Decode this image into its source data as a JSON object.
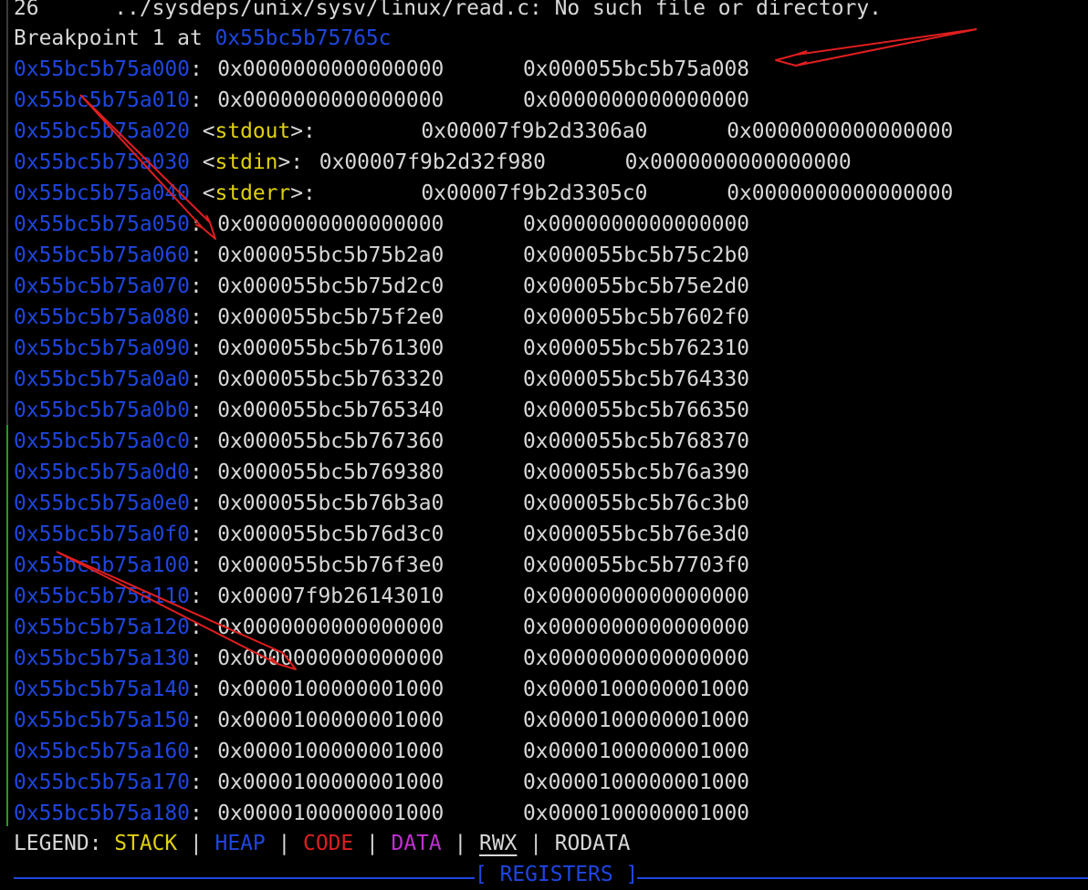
{
  "header_line": "26      ../sysdeps/unix/sysv/linux/read.c: No such file or directory.",
  "breakpoint": {
    "prefix": "Breakpoint 1 at ",
    "address": "0x55bc5b75765c"
  },
  "memory_rows": [
    {
      "addr": "0x55bc5b75a000",
      "sym": "",
      "sep": ": ",
      "v1": "0x0000000000000000",
      "v2": "0x000055bc5b75a008"
    },
    {
      "addr": "0x55bc5b75a010",
      "sym": "",
      "sep": ": ",
      "v1": "0x0000000000000000",
      "v2": "0x0000000000000000"
    },
    {
      "addr": "0x55bc5b75a020",
      "sym": "stdout",
      "sep": ":",
      "v1": "0x00007f9b2d3306a0",
      "v2": "0x0000000000000000"
    },
    {
      "addr": "0x55bc5b75a030",
      "sym": "stdin",
      "sep": ": ",
      "v1": "0x00007f9b2d32f980",
      "v2": "0x0000000000000000"
    },
    {
      "addr": "0x55bc5b75a040",
      "sym": "stderr",
      "sep": ":",
      "v1": "0x00007f9b2d3305c0",
      "v2": "0x0000000000000000"
    },
    {
      "addr": "0x55bc5b75a050",
      "sym": "",
      "sep": ": ",
      "v1": "0x0000000000000000",
      "v2": "0x0000000000000000"
    },
    {
      "addr": "0x55bc5b75a060",
      "sym": "",
      "sep": ": ",
      "v1": "0x000055bc5b75b2a0",
      "v2": "0x000055bc5b75c2b0"
    },
    {
      "addr": "0x55bc5b75a070",
      "sym": "",
      "sep": ": ",
      "v1": "0x000055bc5b75d2c0",
      "v2": "0x000055bc5b75e2d0"
    },
    {
      "addr": "0x55bc5b75a080",
      "sym": "",
      "sep": ": ",
      "v1": "0x000055bc5b75f2e0",
      "v2": "0x000055bc5b7602f0"
    },
    {
      "addr": "0x55bc5b75a090",
      "sym": "",
      "sep": ": ",
      "v1": "0x000055bc5b761300",
      "v2": "0x000055bc5b762310"
    },
    {
      "addr": "0x55bc5b75a0a0",
      "sym": "",
      "sep": ": ",
      "v1": "0x000055bc5b763320",
      "v2": "0x000055bc5b764330"
    },
    {
      "addr": "0x55bc5b75a0b0",
      "sym": "",
      "sep": ": ",
      "v1": "0x000055bc5b765340",
      "v2": "0x000055bc5b766350"
    },
    {
      "addr": "0x55bc5b75a0c0",
      "sym": "",
      "sep": ": ",
      "v1": "0x000055bc5b767360",
      "v2": "0x000055bc5b768370"
    },
    {
      "addr": "0x55bc5b75a0d0",
      "sym": "",
      "sep": ": ",
      "v1": "0x000055bc5b769380",
      "v2": "0x000055bc5b76a390"
    },
    {
      "addr": "0x55bc5b75a0e0",
      "sym": "",
      "sep": ": ",
      "v1": "0x000055bc5b76b3a0",
      "v2": "0x000055bc5b76c3b0"
    },
    {
      "addr": "0x55bc5b75a0f0",
      "sym": "",
      "sep": ": ",
      "v1": "0x000055bc5b76d3c0",
      "v2": "0x000055bc5b76e3d0"
    },
    {
      "addr": "0x55bc5b75a100",
      "sym": "",
      "sep": ": ",
      "v1": "0x000055bc5b76f3e0",
      "v2": "0x000055bc5b7703f0"
    },
    {
      "addr": "0x55bc5b75a110",
      "sym": "",
      "sep": ": ",
      "v1": "0x00007f9b26143010",
      "v2": "0x0000000000000000"
    },
    {
      "addr": "0x55bc5b75a120",
      "sym": "",
      "sep": ": ",
      "v1": "0x0000000000000000",
      "v2": "0x0000000000000000"
    },
    {
      "addr": "0x55bc5b75a130",
      "sym": "",
      "sep": ": ",
      "v1": "0x0000000000000000",
      "v2": "0x0000000000000000"
    },
    {
      "addr": "0x55bc5b75a140",
      "sym": "",
      "sep": ": ",
      "v1": "0x0000100000001000",
      "v2": "0x0000100000001000"
    },
    {
      "addr": "0x55bc5b75a150",
      "sym": "",
      "sep": ": ",
      "v1": "0x0000100000001000",
      "v2": "0x0000100000001000"
    },
    {
      "addr": "0x55bc5b75a160",
      "sym": "",
      "sep": ": ",
      "v1": "0x0000100000001000",
      "v2": "0x0000100000001000"
    },
    {
      "addr": "0x55bc5b75a170",
      "sym": "",
      "sep": ": ",
      "v1": "0x0000100000001000",
      "v2": "0x0000100000001000"
    },
    {
      "addr": "0x55bc5b75a180",
      "sym": "",
      "sep": ": ",
      "v1": "0x0000100000001000",
      "v2": "0x0000100000001000"
    }
  ],
  "legend": {
    "prefix": "LEGEND: ",
    "sep": " | ",
    "stack": "STACK",
    "heap": "HEAP",
    "code": "CODE",
    "data": "DATA",
    "rwx": "RWX",
    "rodata": "RODATA"
  },
  "registers_divider": "[ REGISTERS ]",
  "colors": {
    "address": "#1e46e0",
    "symbol": "#e0d010",
    "text": "#d8d8d8",
    "annotation_arrow": "#e01e1e",
    "pane_border": "#1f9e1f"
  }
}
